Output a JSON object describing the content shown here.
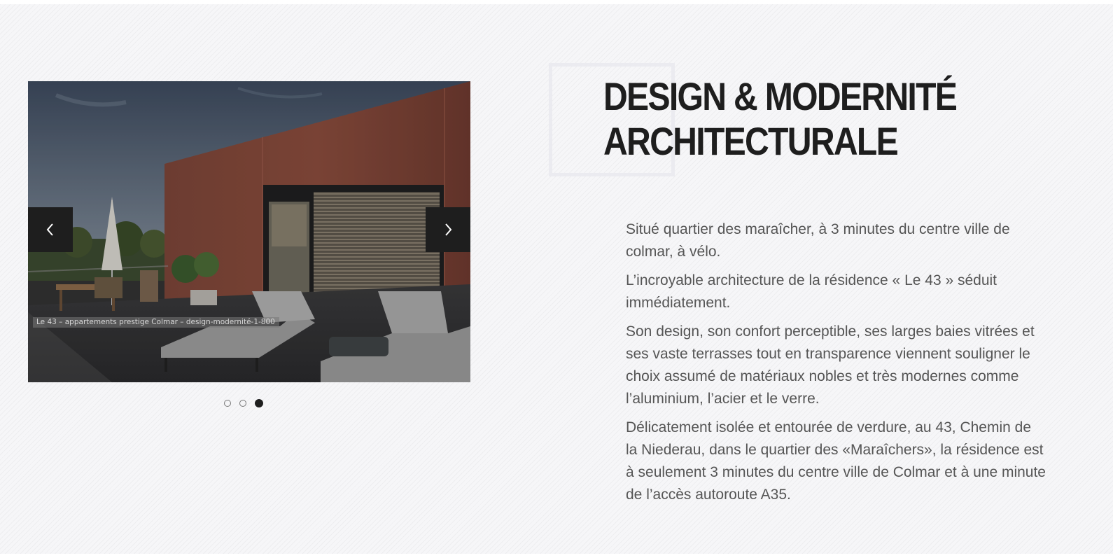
{
  "slider": {
    "caption": "Le 43 – appartements prestige Colmar – design-modernité-1-800",
    "prev_icon": "chevron-left-icon",
    "next_icon": "chevron-right-icon",
    "dot_count": 3,
    "active_slide": 3
  },
  "heading": {
    "line1": "DESIGN & MODERNITÉ",
    "line2": "ARCHITECTURALE"
  },
  "content": {
    "paragraphs": [
      "Situé quartier des maraîcher, à 3 minutes du centre ville de colmar, à vélo.",
      "L’incroyable architecture de la résidence « Le 43 » séduit immédiatement.",
      "Son design, son confort perceptible, ses larges baies vitrées et ses vaste terrasses tout en transparence viennent souligner le choix assumé de matériaux nobles et très modernes comme l’aluminium, l’acier et le verre.",
      "Délicatement isolée et entourée de verdure, au 43, Chemin de la Niederau, dans le quartier des «Maraîchers», la résidence est à seulement 3 minutes du centre ville de Colmar et à une minute de l’accès autoroute A35."
    ]
  },
  "colors": {
    "dark": "#1e1e1e",
    "text": "#555555",
    "facade": "#8a4b3c"
  }
}
